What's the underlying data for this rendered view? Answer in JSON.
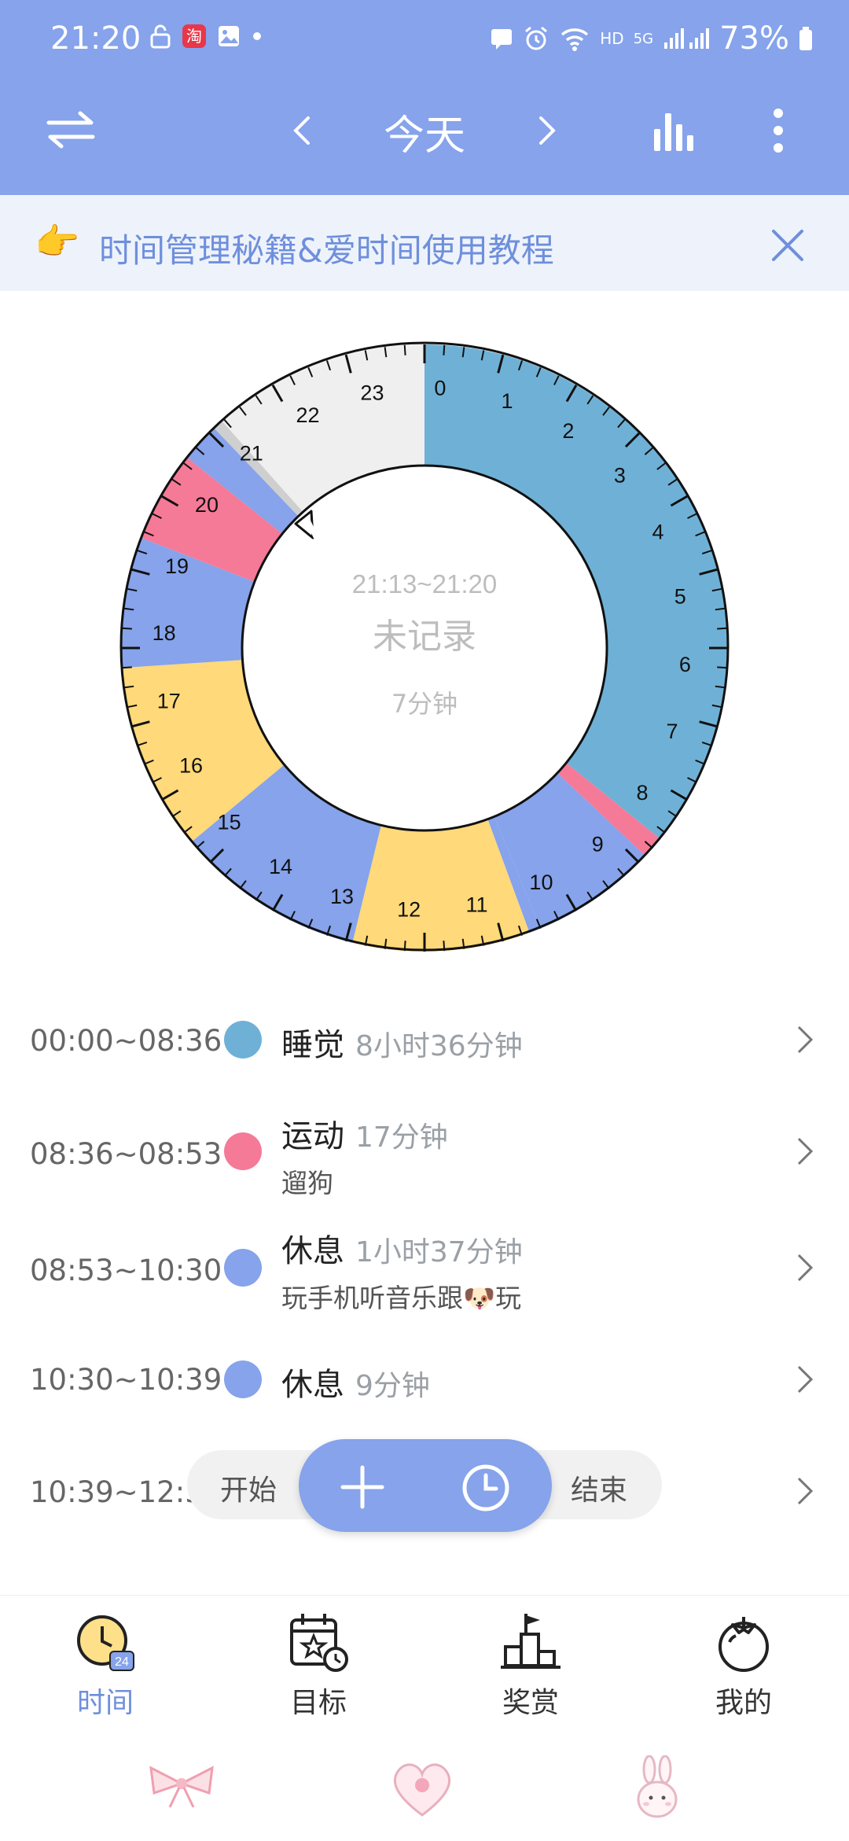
{
  "status_bar": {
    "time": "21:20",
    "battery": "73%",
    "network": "5G",
    "hd": "HD"
  },
  "header": {
    "title": "今天",
    "prev": "‹",
    "next": "›"
  },
  "banner": {
    "emoji": "👉",
    "text": "时间管理秘籍&爱时间使用教程"
  },
  "clock": {
    "center_range": "21:13~21:20",
    "center_label": "未记录",
    "center_duration": "7分钟",
    "hour_labels": [
      "0",
      "1",
      "2",
      "3",
      "4",
      "5",
      "6",
      "7",
      "8",
      "9",
      "10",
      "11",
      "12",
      "13",
      "14",
      "15",
      "16",
      "17",
      "18",
      "19",
      "20",
      "21",
      "22",
      "23"
    ],
    "colors": {
      "sleep": "#6fb1d6",
      "sport": "#f47a97",
      "rest": "#86a3eb",
      "yellow": "#ffd97a",
      "unrecorded": "#efefef",
      "gray": "#cfcfcf"
    },
    "segments": [
      {
        "start": "00:00",
        "end": "08:36",
        "color": "sleep"
      },
      {
        "start": "08:36",
        "end": "08:53",
        "color": "sport"
      },
      {
        "start": "08:53",
        "end": "10:30",
        "color": "rest"
      },
      {
        "start": "10:30",
        "end": "10:39",
        "color": "rest"
      },
      {
        "start": "10:39",
        "end": "12:55",
        "color": "yellow"
      },
      {
        "start": "12:55",
        "end": "15:21",
        "color": "rest"
      },
      {
        "start": "15:21",
        "end": "17:45",
        "color": "yellow"
      },
      {
        "start": "17:45",
        "end": "19:25",
        "color": "rest"
      },
      {
        "start": "19:25",
        "end": "20:35",
        "color": "sport"
      },
      {
        "start": "20:35",
        "end": "21:05",
        "color": "rest"
      },
      {
        "start": "21:05",
        "end": "21:13",
        "color": "gray"
      },
      {
        "start": "21:13",
        "end": "24:00",
        "color": "unrecorded"
      }
    ]
  },
  "timeline": [
    {
      "time": "00:00~08:36",
      "name": "睡觉",
      "duration": "8小时36分钟",
      "note": "",
      "color": "#6fb1d6"
    },
    {
      "time": "08:36~08:53",
      "name": "运动",
      "duration": "17分钟",
      "note": "遛狗",
      "color": "#f47a97"
    },
    {
      "time": "08:53~10:30",
      "name": "休息",
      "duration": "1小时37分钟",
      "note": "玩手机听音乐跟🐶玩",
      "color": "#86a3eb"
    },
    {
      "time": "10:30~10:39",
      "name": "休息",
      "duration": "9分钟",
      "note": "",
      "color": "#86a3eb"
    },
    {
      "time": "10:39~12:5",
      "name": "",
      "duration": "",
      "note": "",
      "color": ""
    }
  ],
  "fab": {
    "start_label": "开始",
    "end_label": "结束"
  },
  "nav": [
    {
      "label": "时间",
      "icon": "clock-24-icon",
      "active": true
    },
    {
      "label": "目标",
      "icon": "calendar-goal-icon",
      "active": false
    },
    {
      "label": "奖赏",
      "icon": "podium-flag-icon",
      "active": false
    },
    {
      "label": "我的",
      "icon": "tomato-icon",
      "active": false
    }
  ]
}
